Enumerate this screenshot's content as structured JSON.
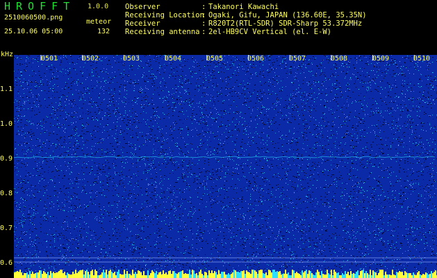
{
  "app": {
    "name": "HROFFT",
    "version": "1.0.0"
  },
  "file": {
    "name": "2510060500.png",
    "datetime": "25.10.06 05:00"
  },
  "meteor": {
    "label": "meteor",
    "count": "132"
  },
  "info": [
    {
      "label": "Observer",
      "value": "Takanori Kawachi"
    },
    {
      "label": "Receiving Location",
      "value": "Ogaki, Gifu, JAPAN (136.60E, 35.35N)"
    },
    {
      "label": "Receiver",
      "value": "R820T2(RTL-SDR) SDR-Sharp 53.372MHz"
    },
    {
      "label": "Receiving antenna",
      "value": "2el-HB9CV Vertical (el. E-W)"
    }
  ],
  "axis": {
    "y_unit": "kHz",
    "y_ticks": [
      "1.1",
      "1.0",
      "0.9",
      "0.8",
      "0.7",
      "0.6"
    ],
    "x_ticks": [
      "0501",
      "0502",
      "0503",
      "0504",
      "0505",
      "0506",
      "0507",
      "0508",
      "0509",
      "0510"
    ]
  },
  "colors": {
    "background": "#000000",
    "text": "#ffff5a",
    "title": "#22e034",
    "plot_base": "#0a2aa8",
    "noise_cyan": "#2ee0ff",
    "noise_dark": "#040a3a",
    "tick_white": "#ffffff"
  }
}
